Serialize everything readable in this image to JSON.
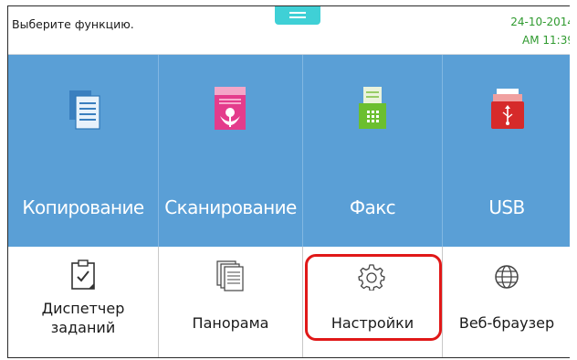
{
  "status": {
    "prompt": "Выберите функцию.",
    "date": "24-10-2014",
    "time": "AM 11:39"
  },
  "tiles": [
    {
      "label": "Копирование",
      "icon": "copy-icon"
    },
    {
      "label": "Сканирование",
      "icon": "scan-icon"
    },
    {
      "label": "Факс",
      "icon": "fax-icon"
    },
    {
      "label": "USB",
      "icon": "usb-icon"
    }
  ],
  "bottom": [
    {
      "label_line1": "Диспетчер",
      "label_line2": "заданий",
      "icon": "clipboard-check-icon"
    },
    {
      "label_line1": "Панорама",
      "icon": "documents-icon"
    },
    {
      "label_line1": "Настройки",
      "icon": "gear-icon"
    },
    {
      "label_line1": "Веб-браузер",
      "icon": "globe-icon"
    }
  ],
  "colors": {
    "tile_bg": "#5a9fd6",
    "accent_handle": "#3fd0d6",
    "datetime": "#2f9a2f",
    "highlight": "#e01818"
  }
}
